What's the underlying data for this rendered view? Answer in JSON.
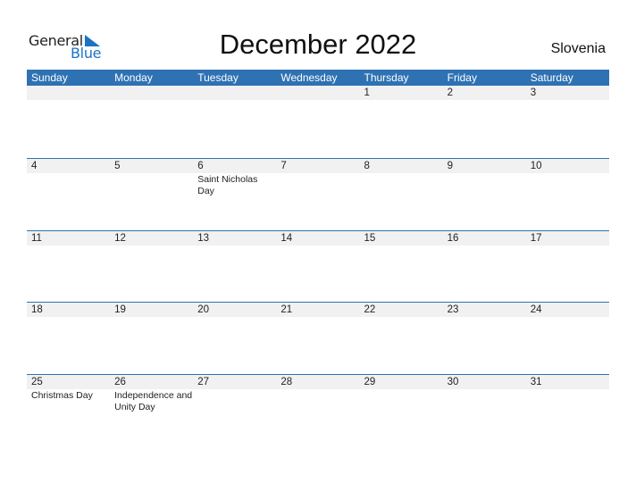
{
  "logo": {
    "general": "General",
    "blue": "Blue"
  },
  "title": "December 2022",
  "country": "Slovenia",
  "colors": {
    "accent": "#2f72b3",
    "logo_blue": "#1a73c7",
    "band": "#f1f1f1"
  },
  "weekdays": [
    "Sunday",
    "Monday",
    "Tuesday",
    "Wednesday",
    "Thursday",
    "Friday",
    "Saturday"
  ],
  "weeks": [
    {
      "days": [
        "",
        "",
        "",
        "",
        "1",
        "2",
        "3"
      ],
      "events": [
        "",
        "",
        "",
        "",
        "",
        "",
        ""
      ]
    },
    {
      "days": [
        "4",
        "5",
        "6",
        "7",
        "8",
        "9",
        "10"
      ],
      "events": [
        "",
        "",
        "Saint Nicholas Day",
        "",
        "",
        "",
        ""
      ]
    },
    {
      "days": [
        "11",
        "12",
        "13",
        "14",
        "15",
        "16",
        "17"
      ],
      "events": [
        "",
        "",
        "",
        "",
        "",
        "",
        ""
      ]
    },
    {
      "days": [
        "18",
        "19",
        "20",
        "21",
        "22",
        "23",
        "24"
      ],
      "events": [
        "",
        "",
        "",
        "",
        "",
        "",
        ""
      ]
    },
    {
      "days": [
        "25",
        "26",
        "27",
        "28",
        "29",
        "30",
        "31"
      ],
      "events": [
        "Christmas Day",
        "Independence and Unity Day",
        "",
        "",
        "",
        "",
        ""
      ]
    }
  ]
}
